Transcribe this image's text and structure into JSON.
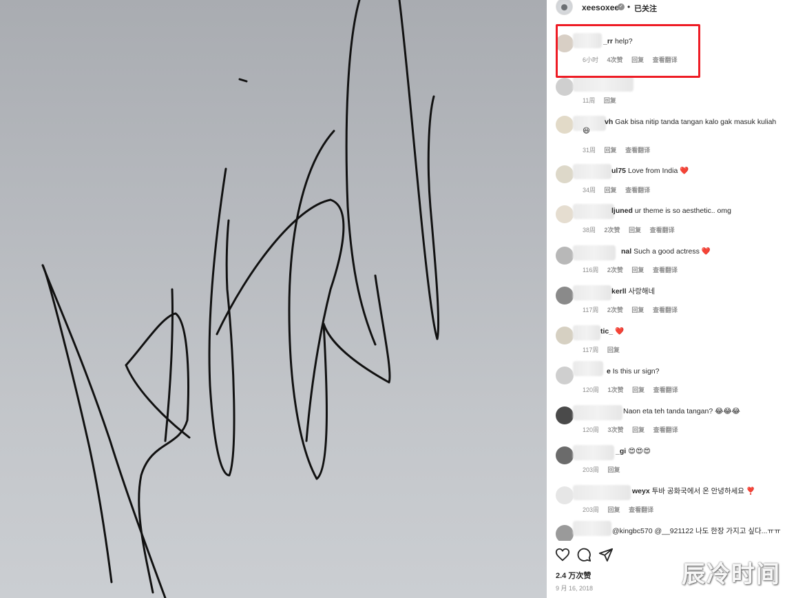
{
  "header": {
    "username": "xeesoxee",
    "separator": "•",
    "follow_label": "已关注"
  },
  "comments": [
    {
      "user_suffix": "_rr",
      "text": "help?",
      "time": "6小时",
      "likes": "4次赞",
      "reply": "回复",
      "translate": "查看翻译"
    },
    {
      "user_suffix": "",
      "text": "",
      "time": "11周",
      "likes": "",
      "reply": "回复",
      "translate": ""
    },
    {
      "user_suffix": "vh",
      "text": "Gak bisa nitip tanda tangan kalo gak masuk kuliah",
      "text2": "😄",
      "time": "31周",
      "likes": "",
      "reply": "回复",
      "translate": "查看翻译"
    },
    {
      "user_suffix": "ul75",
      "text": "Love from India",
      "emoji": "❤️",
      "time": "34周",
      "likes": "",
      "reply": "回复",
      "translate": "查看翻译"
    },
    {
      "user_suffix": "ljuned",
      "text": "ur theme is so aesthetic.. omg",
      "time": "38周",
      "likes": "2次赞",
      "reply": "回复",
      "translate": "查看翻译"
    },
    {
      "user_suffix": "nal",
      "text": "Such a good actress",
      "emoji": "❤️",
      "time": "116周",
      "likes": "2次赞",
      "reply": "回复",
      "translate": "查看翻译"
    },
    {
      "user_suffix": "kerll",
      "text": "사랑해네",
      "time": "117周",
      "likes": "2次赞",
      "reply": "回复",
      "translate": "查看翻译"
    },
    {
      "user_suffix": "tic_",
      "text": "",
      "emoji": "❤️",
      "time": "117周",
      "likes": "",
      "reply": "回复",
      "translate": ""
    },
    {
      "user_suffix": "e",
      "text": "Is this ur sign?",
      "time": "120周",
      "likes": "1次赞",
      "reply": "回复",
      "translate": "查看翻译"
    },
    {
      "user_suffix": "",
      "text": "Naon eta teh tanda tangan? 😂😂😂",
      "time": "120周",
      "likes": "3次赞",
      "reply": "回复",
      "translate": "查看翻译"
    },
    {
      "user_suffix": "_gi",
      "text": "😍😍😍",
      "time": "203周",
      "likes": "",
      "reply": "回复",
      "translate": ""
    },
    {
      "user_suffix": "weyx",
      "text": "투바 공화국에서 온 안녕하세요",
      "emoji": "❣️",
      "time": "203周",
      "likes": "",
      "reply": "回复",
      "translate": "查看翻译"
    },
    {
      "user_suffix": "",
      "text": "@kingbc570 @__921122 나도 한장 가지고 싶다...ㅠㅠ",
      "time": "",
      "likes": "",
      "reply": "",
      "translate": ""
    }
  ],
  "footer": {
    "likes": "2.4 万次赞",
    "date": "9 月 16, 2018"
  },
  "watermark": "辰冷时间",
  "colors": {
    "highlight": "#ee1c25",
    "text": "#262626",
    "meta": "#8e8e8e",
    "heart": "#ed4956"
  },
  "icons": {
    "like": "heart-icon",
    "comment": "comment-icon",
    "share": "share-icon",
    "next": "chevron-right-icon"
  }
}
